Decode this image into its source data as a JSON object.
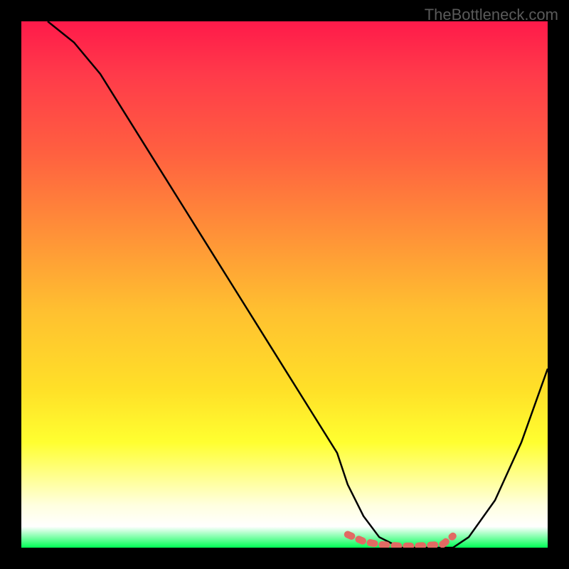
{
  "watermark": "TheBottleneck.com",
  "chart_data": {
    "type": "line",
    "title": "",
    "xlabel": "",
    "ylabel": "",
    "xlim": [
      0,
      100
    ],
    "ylim": [
      0,
      100
    ],
    "series": [
      {
        "name": "bottleneck-curve",
        "color": "#000000",
        "x": [
          5,
          10,
          15,
          20,
          25,
          30,
          35,
          40,
          45,
          50,
          55,
          60,
          62,
          65,
          68,
          72,
          75,
          80,
          82,
          85,
          90,
          95,
          100
        ],
        "y": [
          100,
          96,
          90,
          82,
          74,
          66,
          58,
          50,
          42,
          34,
          26,
          18,
          12,
          6,
          2,
          0,
          0,
          0,
          0,
          2,
          9,
          20,
          34
        ]
      },
      {
        "name": "optimal-range",
        "color": "#e26a63",
        "x": [
          62,
          65,
          68,
          72,
          75,
          80,
          82
        ],
        "y": [
          2.5,
          1.2,
          0.6,
          0.3,
          0.3,
          0.6,
          2.2
        ]
      }
    ],
    "gradient_stops": [
      {
        "pos": 0,
        "color": "#ff1a4a"
      },
      {
        "pos": 10,
        "color": "#ff3a4a"
      },
      {
        "pos": 25,
        "color": "#ff6040"
      },
      {
        "pos": 40,
        "color": "#ff9038"
      },
      {
        "pos": 55,
        "color": "#ffc030"
      },
      {
        "pos": 70,
        "color": "#ffe028"
      },
      {
        "pos": 80,
        "color": "#ffff30"
      },
      {
        "pos": 92,
        "color": "#ffffe0"
      },
      {
        "pos": 96,
        "color": "#ffffff"
      },
      {
        "pos": 100,
        "color": "#00ff55"
      }
    ]
  }
}
